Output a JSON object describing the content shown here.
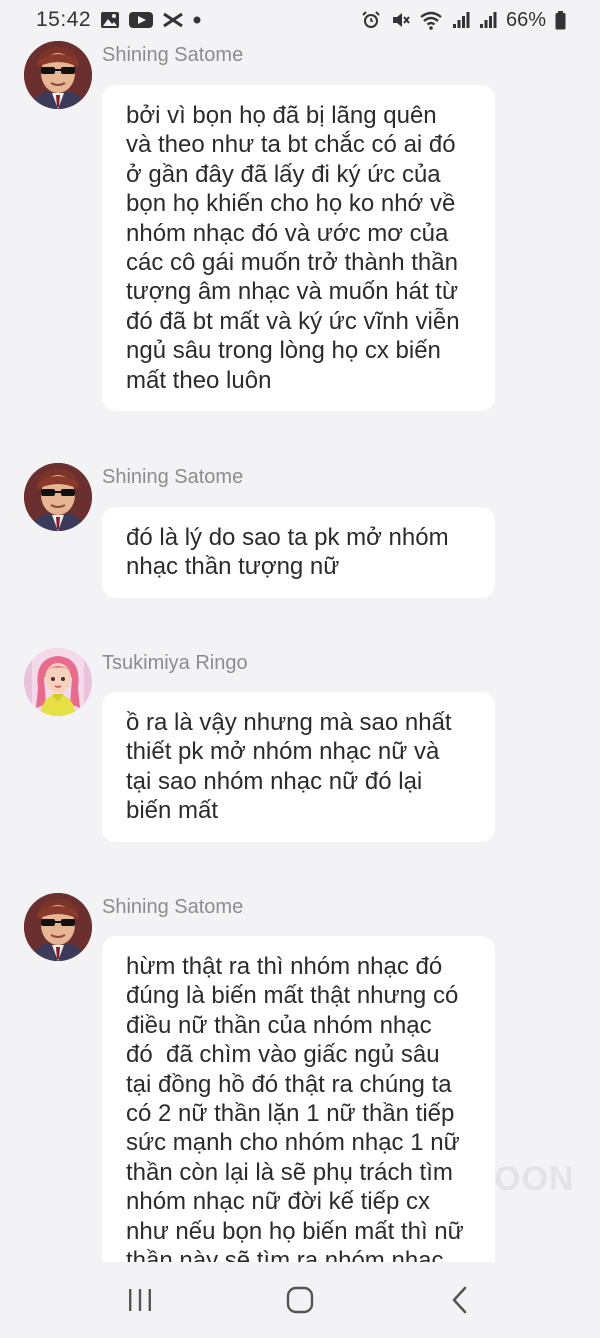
{
  "status_bar": {
    "time": "15:42",
    "battery": "66%"
  },
  "messages": [
    {
      "sender": "Shining Satome",
      "text": "bởi vì bọn họ đã bị lãng quên\nvà theo như ta bt chắc có ai đó\nở gần đây đã lấy đi ký ức của\nbọn họ khiến cho họ ko nhớ về\nnhóm nhạc đó và ước mơ của\ncác cô gái muốn trở thành thần\ntượng âm nhạc và muốn hát từ\nđó đã bt mất và ký ức vĩnh viễn\nngủ sâu trong lòng họ cx biến\nmất theo luôn"
    },
    {
      "sender": "Shining Satome",
      "text": "đó là lý do sao ta pk mở nhóm\nnhạc thần tượng nữ"
    },
    {
      "sender": "Tsukimiya Ringo",
      "text": "ồ ra là vậy nhưng mà sao nhất\nthiết pk mở nhóm nhạc nữ và\ntại sao nhóm nhạc nữ đó lại\nbiến mất"
    },
    {
      "sender": "Shining Satome",
      "text": "hừm thật ra thì nhóm nhạc đó\nđúng là biến mất thật nhưng có\nđiều nữ thần của nhóm nhạc\nđó  đã chìm vào giấc ngủ sâu\ntại đồng hồ đó thật ra chúng ta\ncó 2 nữ thần lặn 1 nữ thần tiếp\nsức mạnh cho nhóm nhạc 1 nữ\nthần còn lại là sẽ phụ trách tìm\nnhóm nhạc nữ đời kế tiếp cx\nnhư nếu bọn họ biến mất thì nữ\nthần này sẽ tìm ra nhóm nhạc"
    }
  ],
  "watermark": "OON"
}
